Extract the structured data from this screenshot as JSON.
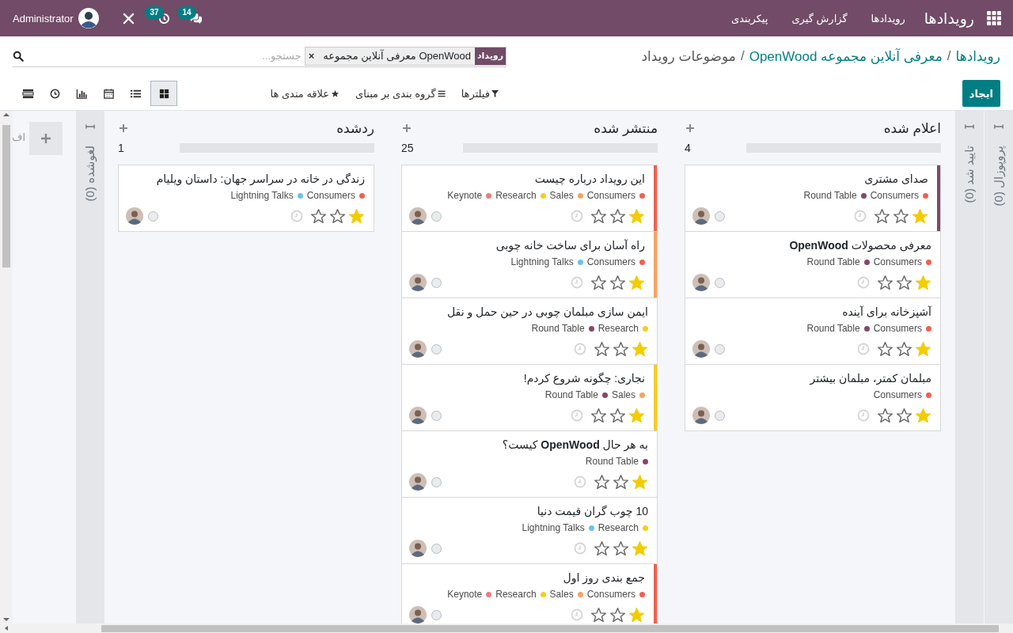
{
  "navbar": {
    "brand": "رویدادها",
    "menu": [
      "رویدادها",
      "گزارش گیری",
      "پیکربندی"
    ],
    "user": "Administrator",
    "activity_count": "37",
    "message_count": "14"
  },
  "breadcrumbs": [
    {
      "kind": "link",
      "text": "رویدادها"
    },
    {
      "kind": "separator",
      "text": "/"
    },
    {
      "kind": "link",
      "text": "معرفی آنلاین مجموعه OpenWood"
    },
    {
      "kind": "separator",
      "text": "/"
    },
    {
      "kind": "current",
      "text": "موضوعات رویداد"
    }
  ],
  "search": {
    "facet_label": "رویداد",
    "facet_value": "معرفی آنلاین مجموعه OpenWood",
    "remove": "×",
    "placeholder": "جستجو..."
  },
  "create_button": "ایجاد",
  "search_options": [
    {
      "kind": "filter",
      "label": "فیلترها"
    },
    {
      "kind": "group",
      "label": "گروه بندی بر مبنای"
    },
    {
      "kind": "favorite",
      "label": "علاقه مندی ها"
    }
  ],
  "views": [
    {
      "kind": "kanban",
      "selected": true
    },
    {
      "kind": "list",
      "selected": false
    },
    {
      "kind": "calendar",
      "selected": false
    },
    {
      "kind": "graph",
      "selected": false
    },
    {
      "kind": "activity",
      "selected": false
    },
    {
      "kind": "table",
      "selected": false
    }
  ],
  "columns": [
    {
      "kind": "folded",
      "title": "پروپوزال (0)"
    },
    {
      "kind": "folded",
      "title": "تایید شد (0)"
    },
    {
      "kind": "open",
      "title": "اعلام شده",
      "count": "4",
      "level": 1,
      "cards": [
        {
          "title": "صدای مشتری",
          "color": "#7b4a6b",
          "stars": 1,
          "tags": [
            {
              "label": "Consumers",
              "color": "#f06050"
            },
            {
              "label": "Round Table",
              "color": "#814968"
            }
          ]
        },
        {
          "title": "معرفی محصولات **OpenWood**",
          "stars": 1,
          "tags": [
            {
              "label": "Consumers",
              "color": "#f06050"
            },
            {
              "label": "Round Table",
              "color": "#814968"
            }
          ]
        },
        {
          "title": "آشپزخانه برای آینده",
          "stars": 1,
          "tags": [
            {
              "label": "Consumers",
              "color": "#f06050"
            },
            {
              "label": "Round Table",
              "color": "#814968"
            }
          ]
        },
        {
          "title": "مبلمان کمتر، مبلمان بیشتر",
          "stars": 1,
          "tags": [
            {
              "label": "Consumers",
              "color": "#f06050"
            }
          ]
        }
      ]
    },
    {
      "kind": "open",
      "title": "منتشر شده",
      "count": "25",
      "level": 1,
      "cards": [
        {
          "title": "این رویداد درباره چیست",
          "color": "#f06050",
          "stars": 1,
          "tags": [
            {
              "label": "Consumers",
              "color": "#f06050"
            },
            {
              "label": "Sales",
              "color": "#f4a460"
            },
            {
              "label": "Research",
              "color": "#f7cd1f"
            },
            {
              "label": "Keynote",
              "color": "#eb7e7f"
            }
          ]
        },
        {
          "title": "راه آسان برای ساخت خانه چوبی",
          "color": "#f4a460",
          "stars": 1,
          "tags": [
            {
              "label": "Consumers",
              "color": "#f06050"
            },
            {
              "label": "Lightning Talks",
              "color": "#6cc1ed"
            }
          ]
        },
        {
          "title": "ایمن سازی مبلمان چوبی در حین حمل و نقل",
          "stars": 1,
          "tags": [
            {
              "label": "Research",
              "color": "#f7cd1f"
            },
            {
              "label": "Round Table",
              "color": "#814968"
            }
          ]
        },
        {
          "title": "نجاری: چگونه شروع کردم!",
          "color": "#f7cd1f",
          "stars": 1,
          "tags": [
            {
              "label": "Sales",
              "color": "#f4a460"
            },
            {
              "label": "Round Table",
              "color": "#814968"
            }
          ]
        },
        {
          "title": "به هر حال **OpenWood** کیست؟",
          "stars": 1,
          "tags": [
            {
              "label": "Round Table",
              "color": "#814968"
            }
          ]
        },
        {
          "title": "10 چوب گران قیمت دنیا",
          "stars": 1,
          "tags": [
            {
              "label": "Research",
              "color": "#f7cd1f"
            },
            {
              "label": "Lightning Talks",
              "color": "#6cc1ed"
            }
          ]
        },
        {
          "title": "جمع بندی روز اول",
          "color": "#f06050",
          "stars": 1,
          "tags": [
            {
              "label": "Consumers",
              "color": "#f06050"
            },
            {
              "label": "Sales",
              "color": "#f4a460"
            },
            {
              "label": "Research",
              "color": "#f7cd1f"
            },
            {
              "label": "Keynote",
              "color": "#eb7e7f"
            }
          ]
        }
      ]
    },
    {
      "kind": "open",
      "title": "ردشده",
      "count": "1",
      "level": 1,
      "cards": [
        {
          "title": "زندگی در خانه در سراسر جهان: داستان ویلیام",
          "stars": 1,
          "tags": [
            {
              "label": "Consumers",
              "color": "#f06050"
            },
            {
              "label": "Lightning Talks",
              "color": "#6cc1ed"
            }
          ]
        }
      ]
    },
    {
      "kind": "folded",
      "title": "لغوشده (0)"
    }
  ],
  "add_column": {
    "label": "اف"
  }
}
